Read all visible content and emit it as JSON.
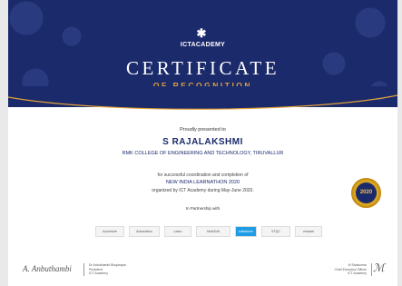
{
  "colors": {
    "navy": "#1b2a6b",
    "gold": "#e2a23a",
    "badge_gold": "#d9a521"
  },
  "header": {
    "logo_icon": "ict-academy-logo-icon",
    "logo_text": "ICTACADEMY",
    "title": "CERTIFICATE",
    "subtitle": "OF RECOGNITION"
  },
  "body": {
    "presented": "Proudly presented to",
    "name": "S RAJALAKSHMI",
    "college": "RMK COLLEGE OF ENGINEERING AND TECHNOLOGY, TIRUVALLUR",
    "line1": "for successful coordination and completion of",
    "event": "NEW INDIA LEARNATHON 2020",
    "line3": "organized by ICT Academy during May-June 2020.",
    "partnership": "In Partnership with"
  },
  "badge": {
    "year": "2020"
  },
  "partners": [
    {
      "label": "Accenture",
      "icon": "accenture-logo-icon"
    },
    {
      "label": "Automation",
      "icon": "automation-logo-icon"
    },
    {
      "label": "Learn",
      "icon": "learn-logo-icon"
    },
    {
      "label": "MuleSoft",
      "icon": "mulesoft-logo-icon"
    },
    {
      "label": "salesforce",
      "icon": "salesforce-logo-icon"
    },
    {
      "label": "STQC",
      "icon": "stqc-logo-icon"
    },
    {
      "label": "vmware",
      "icon": "vmware-logo-icon"
    }
  ],
  "signatories": {
    "left": {
      "name": "Dr Anbuthambi Bhojarajan",
      "role": "President",
      "org": "ICT Academy"
    },
    "right": {
      "name": "M Sivakumar",
      "role": "Chief Executive Officer",
      "org": "ICT Academy"
    }
  }
}
